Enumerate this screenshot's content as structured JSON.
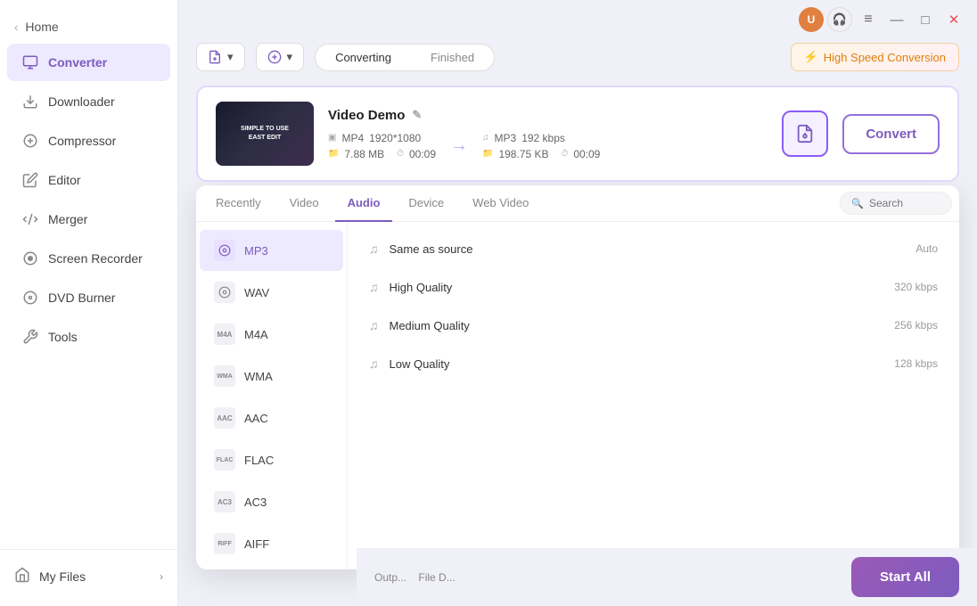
{
  "sidebar": {
    "home_label": "Home",
    "items": [
      {
        "id": "converter",
        "label": "Converter",
        "active": true
      },
      {
        "id": "downloader",
        "label": "Downloader",
        "active": false
      },
      {
        "id": "compressor",
        "label": "Compressor",
        "active": false
      },
      {
        "id": "editor",
        "label": "Editor",
        "active": false
      },
      {
        "id": "merger",
        "label": "Merger",
        "active": false
      },
      {
        "id": "screen-recorder",
        "label": "Screen Recorder",
        "active": false
      },
      {
        "id": "dvd-burner",
        "label": "DVD Burner",
        "active": false
      },
      {
        "id": "tools",
        "label": "Tools",
        "active": false
      }
    ],
    "my_files_label": "My Files"
  },
  "topbar": {
    "converting_label": "Converting",
    "finished_label": "Finished",
    "high_speed_label": "High Speed Conversion",
    "search_placeholder": "Search"
  },
  "video_card": {
    "title": "Video Demo",
    "input_format": "MP4",
    "input_resolution": "1920*1080",
    "input_size": "7.88 MB",
    "input_duration": "00:09",
    "output_format": "MP3",
    "output_bitrate": "192 kbps",
    "output_size": "198.75 KB",
    "output_duration": "00:09",
    "convert_label": "Convert"
  },
  "format_picker": {
    "tabs": [
      "Recently",
      "Video",
      "Audio",
      "Device",
      "Web Video"
    ],
    "active_tab": "Audio",
    "formats": [
      {
        "id": "mp3",
        "label": "MP3",
        "active": true
      },
      {
        "id": "wav",
        "label": "WAV",
        "active": false
      },
      {
        "id": "m4a",
        "label": "M4A",
        "active": false
      },
      {
        "id": "wma",
        "label": "WMA",
        "active": false
      },
      {
        "id": "aac",
        "label": "AAC",
        "active": false
      },
      {
        "id": "flac",
        "label": "FLAC",
        "active": false
      },
      {
        "id": "ac3",
        "label": "AC3",
        "active": false
      },
      {
        "id": "aiff",
        "label": "AIFF",
        "active": false
      }
    ],
    "quality_options": [
      {
        "id": "same-as-source",
        "label": "Same as source",
        "quality": "Auto"
      },
      {
        "id": "high-quality",
        "label": "High Quality",
        "quality": "320 kbps"
      },
      {
        "id": "medium-quality",
        "label": "Medium Quality",
        "quality": "256 kbps"
      },
      {
        "id": "low-quality",
        "label": "Low Quality",
        "quality": "128 kbps"
      }
    ]
  },
  "bottom": {
    "output_label": "Outp...",
    "file_label": "File D...",
    "start_all_label": "Start All"
  },
  "thumb_text": "SIMPLE TO USE\nEAST EDIT",
  "accent_color": "#7c5cbf",
  "icons": {
    "home_chevron": "‹",
    "edit_icon": "✎",
    "lightning": "⚡",
    "search": "🔍",
    "music": "♫",
    "settings": "⚙",
    "arrow_right": "→",
    "user": "👤",
    "headset": "🎧",
    "menu": "≡",
    "minimize": "—",
    "maximize": "□",
    "close": "✕"
  }
}
